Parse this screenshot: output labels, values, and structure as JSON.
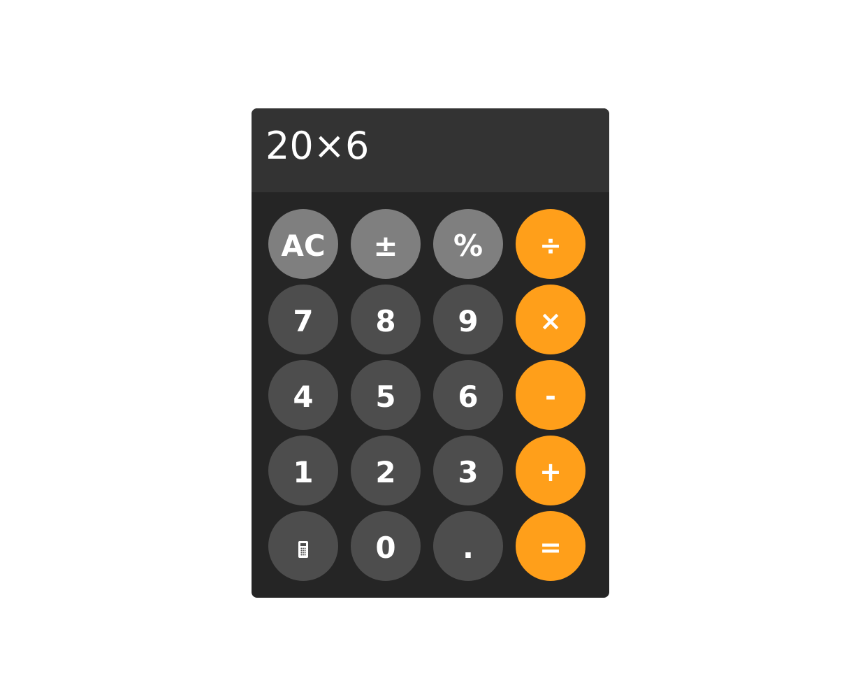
{
  "display": {
    "expression": "20×6"
  },
  "keys": [
    {
      "label": "AC",
      "kind": "func",
      "name": "clear-button"
    },
    {
      "label": "±",
      "kind": "func",
      "name": "plus-minus-button"
    },
    {
      "label": "%",
      "kind": "func",
      "name": "percent-button"
    },
    {
      "label": "÷",
      "kind": "op",
      "name": "divide-button"
    },
    {
      "label": "7",
      "kind": "num",
      "name": "digit-7-button"
    },
    {
      "label": "8",
      "kind": "num",
      "name": "digit-8-button"
    },
    {
      "label": "9",
      "kind": "num",
      "name": "digit-9-button"
    },
    {
      "label": "×",
      "kind": "op",
      "name": "multiply-button"
    },
    {
      "label": "4",
      "kind": "num",
      "name": "digit-4-button"
    },
    {
      "label": "5",
      "kind": "num",
      "name": "digit-5-button"
    },
    {
      "label": "6",
      "kind": "num",
      "name": "digit-6-button"
    },
    {
      "label": "-",
      "kind": "op",
      "name": "subtract-button"
    },
    {
      "label": "1",
      "kind": "num",
      "name": "digit-1-button"
    },
    {
      "label": "2",
      "kind": "num",
      "name": "digit-2-button"
    },
    {
      "label": "3",
      "kind": "num",
      "name": "digit-3-button"
    },
    {
      "label": "+",
      "kind": "op",
      "name": "add-button"
    },
    {
      "label": "",
      "kind": "num",
      "name": "calculator-mode-button",
      "icon": "calculator-icon"
    },
    {
      "label": "0",
      "kind": "num",
      "name": "digit-0-button"
    },
    {
      "label": ".",
      "kind": "num",
      "name": "decimal-button"
    },
    {
      "label": "=",
      "kind": "op",
      "name": "equals-button"
    }
  ],
  "colors": {
    "function_key": "#7f7f7f",
    "number_key": "#4d4d4d",
    "operator_key": "#ff9f1a",
    "display_bg": "#333333",
    "body_bg": "#252525"
  }
}
